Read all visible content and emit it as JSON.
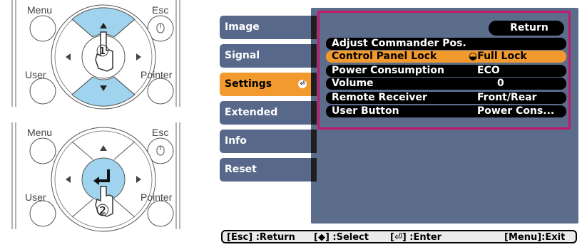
{
  "remote_top": {
    "labels": {
      "menu": "Menu",
      "esc": "Esc",
      "user": "User",
      "pointer": "Pointer"
    },
    "step_marker": "①",
    "highlight_color": "#9fd3ee"
  },
  "remote_bottom": {
    "labels": {
      "menu": "Menu",
      "esc": "Esc",
      "user": "User",
      "pointer": "Pointer"
    },
    "step_marker": "②",
    "highlight_color": "#9fd3ee"
  },
  "sidebar": {
    "items": [
      {
        "label": "Image"
      },
      {
        "label": "Signal"
      },
      {
        "label": "Settings",
        "active": true
      },
      {
        "label": "Extended"
      },
      {
        "label": "Info"
      },
      {
        "label": "Reset"
      }
    ]
  },
  "panel": {
    "return_label": "Return",
    "rows": [
      {
        "label": "Adjust Commander Pos.",
        "value": ""
      },
      {
        "label": "Control Panel Lock",
        "value": "Full Lock",
        "selected": true
      },
      {
        "label": "Power Consumption",
        "value": "ECO"
      },
      {
        "label": "Volume",
        "value": "0"
      },
      {
        "label": "Remote Receiver",
        "value": "Front/Rear"
      },
      {
        "label": "User Button",
        "value": "Power Cons..."
      }
    ],
    "highlight_color": "#c21a6b"
  },
  "status_bar": {
    "return": "[Esc] :Return",
    "select": "[◆] :Select",
    "enter": "[⏎] :Enter",
    "exit": "[Menu]:Exit"
  },
  "colors": {
    "menu_bg": "#5c6c8b",
    "sidebar_bg": "#58688a",
    "selection": "#f29a2e"
  }
}
